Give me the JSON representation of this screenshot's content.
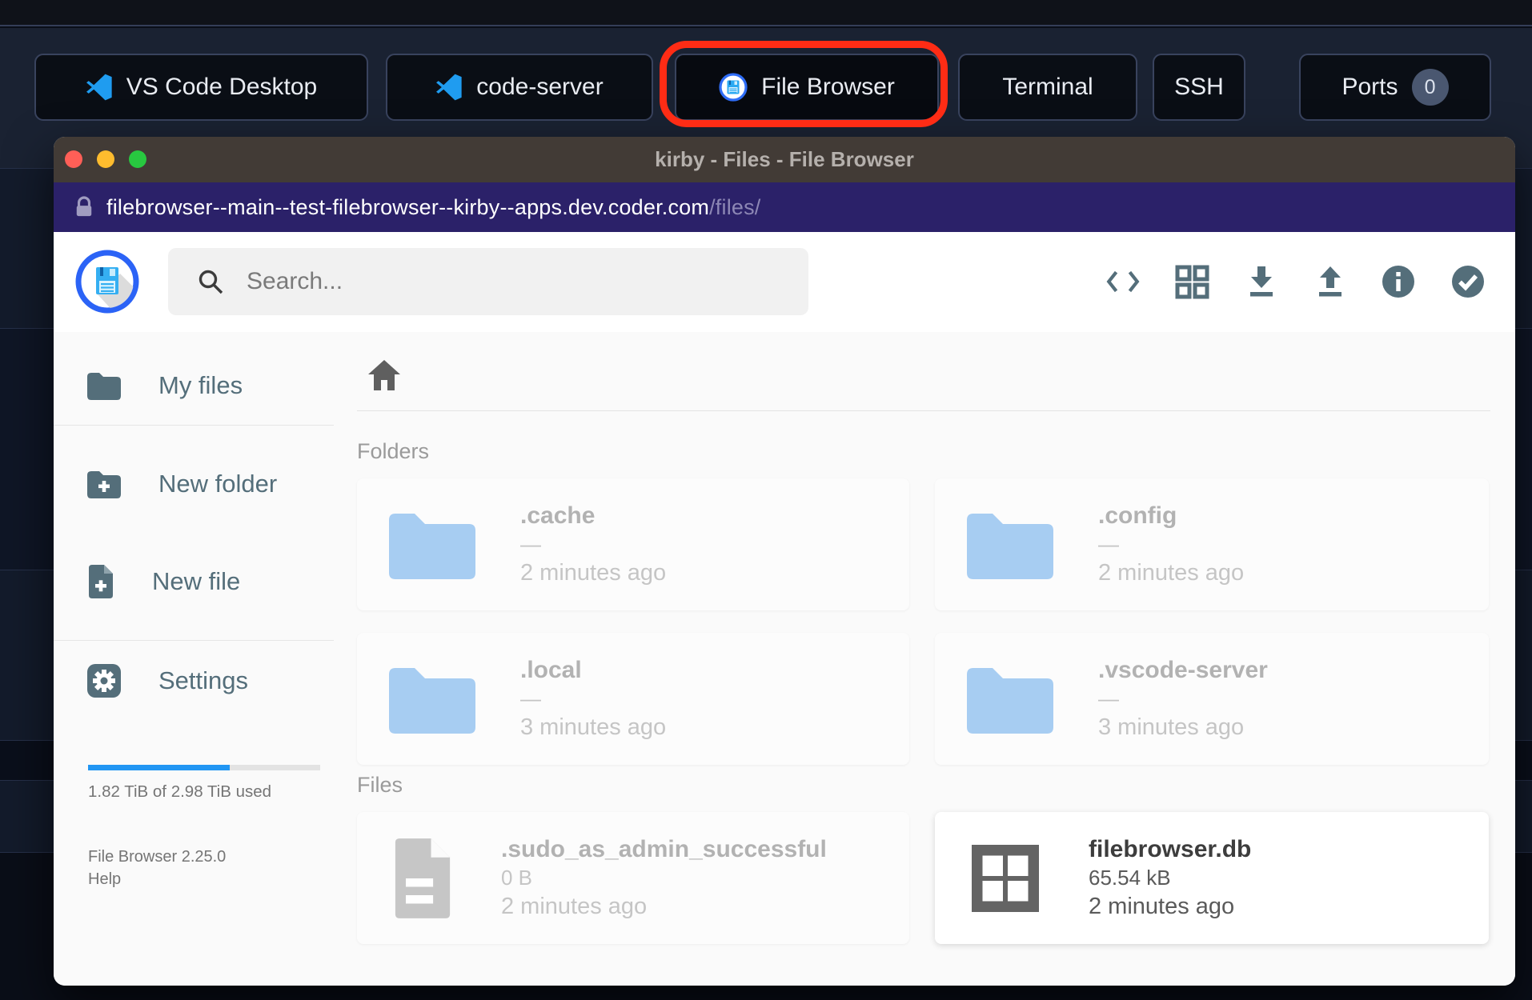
{
  "topbar": {
    "buttons": [
      {
        "label": "VS Code Desktop"
      },
      {
        "label": "code-server"
      },
      {
        "label": "File Browser"
      },
      {
        "label": "Terminal"
      },
      {
        "label": "SSH"
      },
      {
        "label": "Ports",
        "badge": "0"
      }
    ]
  },
  "window": {
    "title": "kirby - Files - File Browser",
    "url_host": "filebrowser--main--test-filebrowser--kirby--apps.dev.coder.com",
    "url_path": "/files/"
  },
  "toolbar": {
    "search_placeholder": "Search...",
    "icons": [
      "code-icon",
      "grid-view-icon",
      "download-icon",
      "upload-icon",
      "info-icon",
      "select-icon"
    ]
  },
  "sidebar": {
    "items": [
      {
        "label": "My files"
      },
      {
        "label": "New folder"
      },
      {
        "label": "New file"
      },
      {
        "label": "Settings"
      }
    ],
    "usage": {
      "label": "1.82 TiB of 2.98 TiB used",
      "fill_style": "width:61%"
    },
    "version": "File Browser 2.25.0",
    "help_label": "Help"
  },
  "content": {
    "sections": [
      {
        "title": "Folders"
      },
      {
        "title": "Files"
      }
    ],
    "folders": [
      {
        "name": ".cache",
        "size": "—",
        "modified": "2 minutes ago"
      },
      {
        "name": ".config",
        "size": "—",
        "modified": "2 minutes ago"
      },
      {
        "name": ".local",
        "size": "—",
        "modified": "3 minutes ago"
      },
      {
        "name": ".vscode-server",
        "size": "—",
        "modified": "3 minutes ago"
      }
    ],
    "files": [
      {
        "name": ".sudo_as_admin_successful",
        "size": "0 B",
        "modified": "2 minutes ago"
      },
      {
        "name": "filebrowser.db",
        "size": "65.54 kB",
        "modified": "2 minutes ago"
      }
    ]
  },
  "colors": {
    "accent_blue": "#2196f3",
    "annotation_red": "#fe2c15",
    "folder_blue": "#a7cdf2",
    "icon_slate": "#546e7a",
    "url_bar": "#2b2169",
    "titlebar": "#423b36"
  }
}
